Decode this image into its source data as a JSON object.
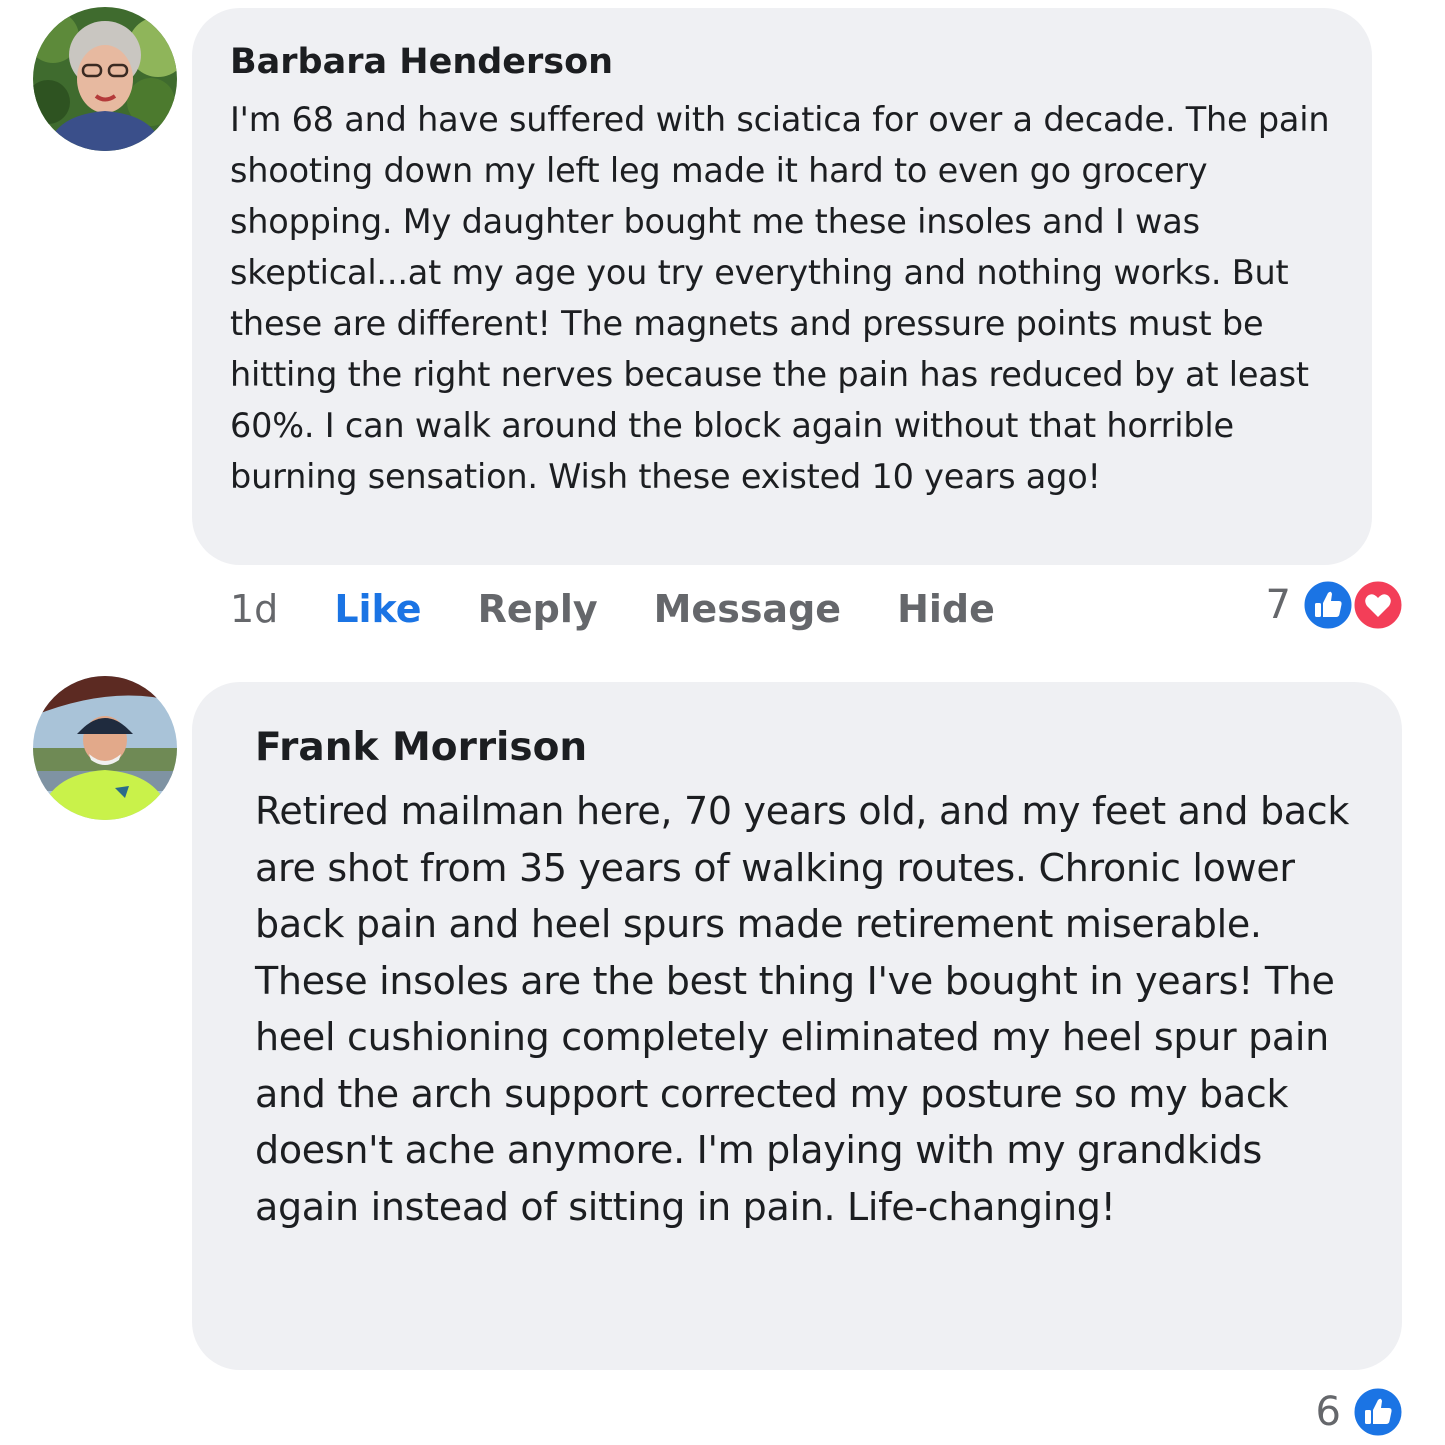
{
  "comments": [
    {
      "author": "Barbara Henderson",
      "text": "I'm 68 and have suffered with sciatica for over a decade. The pain shooting down my left leg made it hard to even go grocery shopping. My daughter bought me these insoles and I was skeptical...at my age you try everything and nothing works. But these are different! The magnets and pressure points must be hitting the right nerves because the pain has reduced by at least 60%. I can walk around the block again without that horrible burning sensation. Wish these existed 10 years ago!",
      "time": "1d",
      "actions": {
        "like": "Like",
        "reply": "Reply",
        "message": "Message",
        "hide": "Hide"
      },
      "reaction_count": "7",
      "reactions": [
        "like-icon",
        "love-icon"
      ]
    },
    {
      "author": "Frank Morrison",
      "text": "Retired mailman here, 70 years old, and my feet and back are shot from 35 years of walking routes. Chronic lower back pain and heel spurs made retirement miserable. These insoles are the best thing I've bought in years! The heel cushioning completely eliminated my heel spur pain and the arch support corrected my posture so my back doesn't ache anymore. I'm playing with my grandkids again instead of sitting in pain. Life-changing!",
      "reaction_count": "6",
      "reactions": [
        "like-icon"
      ]
    }
  ],
  "colors": {
    "bubble": "#eff0f3",
    "like_blue": "#1b74e4",
    "love_red": "#f33e58",
    "muted": "#65676b"
  }
}
